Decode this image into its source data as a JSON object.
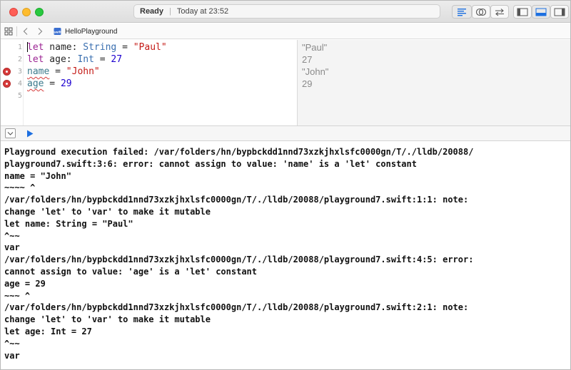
{
  "titlebar": {
    "status": "Ready",
    "separator": "|",
    "time_text": "Today at 23:52"
  },
  "jumpbar": {
    "file_name": "HelloPlayground",
    "file_icon_text": "swift"
  },
  "editor": {
    "line_numbers": [
      "1",
      "2",
      "3",
      "4",
      "5"
    ],
    "lines": [
      [
        {
          "t": "let",
          "c": "kw"
        },
        {
          "t": " name: ",
          "c": ""
        },
        {
          "t": "String",
          "c": "ty"
        },
        {
          "t": " = ",
          "c": ""
        },
        {
          "t": "\"Paul\"",
          "c": "str"
        }
      ],
      [
        {
          "t": "let",
          "c": "kw"
        },
        {
          "t": " age: ",
          "c": ""
        },
        {
          "t": "Int",
          "c": "ty"
        },
        {
          "t": " = ",
          "c": ""
        },
        {
          "t": "27",
          "c": "num"
        }
      ],
      [
        {
          "t": "name",
          "c": "errvar"
        },
        {
          "t": " = ",
          "c": ""
        },
        {
          "t": "\"John\"",
          "c": "str"
        }
      ],
      [
        {
          "t": "age",
          "c": "errvar"
        },
        {
          "t": " = ",
          "c": ""
        },
        {
          "t": "29",
          "c": "num"
        }
      ],
      []
    ],
    "error_lines": [
      3,
      4
    ],
    "results": [
      "\"Paul\"",
      "27",
      "\"John\"",
      "29"
    ]
  },
  "console": {
    "lines": [
      "Playground execution failed: /var/folders/hn/bypbckdd1nnd73xzkjhxlsfc0000gn/T/./lldb/20088/",
      "playground7.swift:3:6: error: cannot assign to value: 'name' is a 'let' constant",
      "name = \"John\"",
      "~~~~ ^",
      "/var/folders/hn/bypbckdd1nnd73xzkjhxlsfc0000gn/T/./lldb/20088/playground7.swift:1:1: note:",
      "change 'let' to 'var' to make it mutable",
      "let name: String = \"Paul\"",
      "^~~",
      "var",
      "/var/folders/hn/bypbckdd1nnd73xzkjhxlsfc0000gn/T/./lldb/20088/playground7.swift:4:5: error:",
      "cannot assign to value: 'age' is a 'let' constant",
      "age = 29",
      "~~~ ^",
      "/var/folders/hn/bypbckdd1nnd73xzkjhxlsfc0000gn/T/./lldb/20088/playground7.swift:2:1: note:",
      "change 'let' to 'var' to make it mutable",
      "let age: Int = 27",
      "^~~",
      "var"
    ]
  },
  "colors": {
    "keyword": "#9b2393",
    "type": "#3a6fb0",
    "string": "#c41a16",
    "number": "#1c00cf",
    "error": "#d63a3a",
    "accent": "#1d6fe0"
  },
  "icons": {
    "titlebar": [
      "editor-standard-icon",
      "version-compare-icon",
      "assistant-arrows-icon",
      "left-panel-icon",
      "bottom-panel-icon",
      "right-panel-icon"
    ],
    "jumpbar": [
      "grid-icon",
      "back-chevron-icon",
      "forward-chevron-icon",
      "swift-file-icon"
    ],
    "debugbar": [
      "hide-console-icon",
      "run-play-icon"
    ]
  }
}
